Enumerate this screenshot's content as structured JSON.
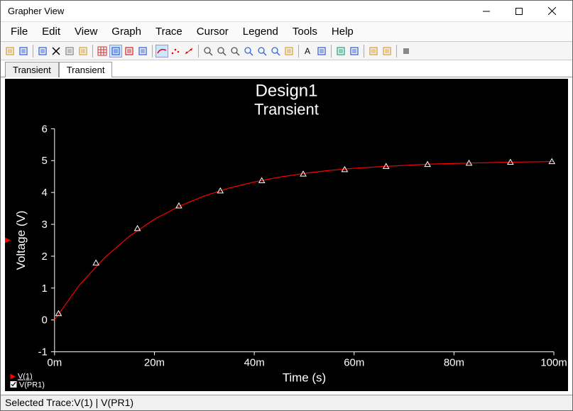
{
  "window": {
    "title": "Grapher View"
  },
  "menu": {
    "items": [
      "File",
      "Edit",
      "View",
      "Graph",
      "Trace",
      "Cursor",
      "Legend",
      "Tools",
      "Help"
    ]
  },
  "toolbar_icons": [
    "open-icon",
    "save-icon",
    "sep",
    "undo-icon",
    "delete-icon",
    "copy-icon",
    "paste-icon",
    "sep",
    "grid-icon",
    "legend-icon",
    "axes-icon",
    "palette-icon",
    "sep",
    "trace-red-icon",
    "samples-icon",
    "markers-icon",
    "sep",
    "zoom-in-icon",
    "zoom-out-icon",
    "zoom-area-icon",
    "zoom-fit-icon",
    "zoom-x-icon",
    "zoom-y-icon",
    "pan-icon",
    "sep",
    "text-icon",
    "arrow-icon",
    "sep",
    "excel-export-icon",
    "options-icon",
    "sep",
    "data-icon",
    "data2-icon",
    "sep",
    "stop-icon"
  ],
  "tabs": {
    "items": [
      "Transient",
      "Transient"
    ],
    "active_index": 1
  },
  "chart_data": {
    "type": "line",
    "title": "Design1",
    "subtitle": "Transient",
    "xlabel": "Time (s)",
    "ylabel": "Voltage (V)",
    "x_ticks": [
      "0m",
      "20m",
      "40m",
      "60m",
      "80m",
      "100m"
    ],
    "y_ticks": [
      -1,
      0,
      1,
      2,
      3,
      4,
      5,
      6
    ],
    "xlim_ms": [
      0,
      100
    ],
    "ylim": [
      -1,
      6
    ],
    "series": [
      {
        "name": "V(1)",
        "color": "#ff0000",
        "x_ms": [
          0,
          5,
          10,
          15,
          20,
          25,
          30,
          35,
          40,
          45,
          50,
          55,
          60,
          65,
          70,
          75,
          80,
          85,
          90,
          95,
          100
        ],
        "y": [
          0,
          1.1,
          1.95,
          2.63,
          3.16,
          3.57,
          3.89,
          4.14,
          4.33,
          4.48,
          4.6,
          4.69,
          4.76,
          4.81,
          4.85,
          4.89,
          4.91,
          4.93,
          4.95,
          4.96,
          4.97
        ]
      }
    ],
    "markers": {
      "x_ms": [
        0.8,
        8.3,
        16.6,
        24.9,
        33.2,
        41.5,
        49.8,
        58.1,
        66.4,
        74.7,
        83.0,
        91.3,
        99.6
      ],
      "y": [
        0.2,
        1.79,
        2.87,
        3.58,
        4.05,
        4.37,
        4.58,
        4.72,
        4.82,
        4.88,
        4.92,
        4.95,
        4.97
      ]
    },
    "legend_traces": [
      "V(1)",
      "V(PR1)"
    ],
    "legend_checked": [
      false,
      true
    ]
  },
  "status": {
    "text": "Selected Trace:V(1) | V(PR1)"
  }
}
